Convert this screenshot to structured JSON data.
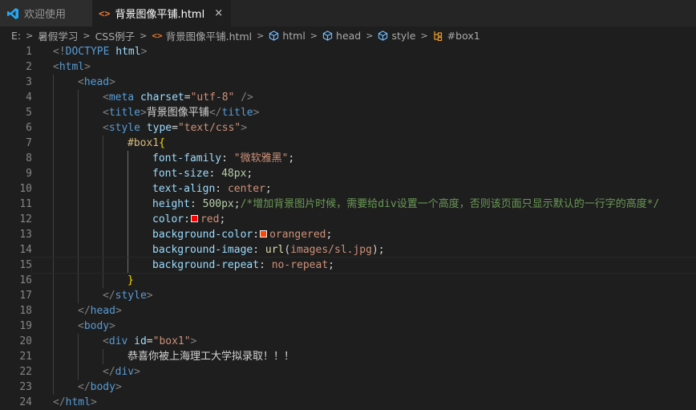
{
  "tabs": [
    {
      "label": "欢迎使用",
      "active": false
    },
    {
      "label": "背景图像平铺.html",
      "active": true,
      "close": "×"
    }
  ],
  "breadcrumb": [
    "E:",
    "暑假学习",
    "CSS例子",
    "背景图像平铺.html",
    "html",
    "head",
    "style",
    "#box1"
  ],
  "colors": {
    "red": "#ff0000",
    "orangered": "#ff4500",
    "accent": "#0078d4"
  },
  "icons": {
    "app": "vscode-icon",
    "file": "html-icon",
    "close": "close-icon",
    "element": "cube-icon",
    "selector": "selector-icon"
  },
  "editor": {
    "lines": [
      {
        "n": "1",
        "i": 0,
        "t": [
          [
            "punc",
            "<!"
          ],
          [
            "tag",
            "DOCTYPE"
          ],
          [
            "txt",
            " "
          ],
          [
            "attr",
            "html"
          ],
          [
            "punc",
            ">"
          ]
        ]
      },
      {
        "n": "2",
        "i": 0,
        "t": [
          [
            "punc",
            "<"
          ],
          [
            "tag",
            "html"
          ],
          [
            "punc",
            ">"
          ]
        ]
      },
      {
        "n": "3",
        "i": 1,
        "t": [
          [
            "punc",
            "<"
          ],
          [
            "tag",
            "head"
          ],
          [
            "punc",
            ">"
          ]
        ]
      },
      {
        "n": "4",
        "i": 2,
        "t": [
          [
            "punc",
            "<"
          ],
          [
            "tag",
            "meta"
          ],
          [
            "txt",
            " "
          ],
          [
            "attr",
            "charset"
          ],
          [
            "txt",
            "="
          ],
          [
            "str",
            "\"utf-8\""
          ],
          [
            "txt",
            " "
          ],
          [
            "punc",
            "/>"
          ]
        ]
      },
      {
        "n": "5",
        "i": 2,
        "t": [
          [
            "punc",
            "<"
          ],
          [
            "tag",
            "title"
          ],
          [
            "punc",
            ">"
          ],
          [
            "txt",
            "背景图像平铺"
          ],
          [
            "punc",
            "</"
          ],
          [
            "tag",
            "title"
          ],
          [
            "punc",
            ">"
          ]
        ]
      },
      {
        "n": "6",
        "i": 2,
        "t": [
          [
            "punc",
            "<"
          ],
          [
            "tag",
            "style"
          ],
          [
            "txt",
            " "
          ],
          [
            "attr",
            "type"
          ],
          [
            "txt",
            "="
          ],
          [
            "str",
            "\"text/css\""
          ],
          [
            "punc",
            ">"
          ]
        ]
      },
      {
        "n": "7",
        "i": 3,
        "t": [
          [
            "sel",
            "#box1"
          ],
          [
            "brace",
            "{"
          ]
        ]
      },
      {
        "n": "8",
        "i": 4,
        "t": [
          [
            "prop",
            "font-family"
          ],
          [
            "txt",
            ": "
          ],
          [
            "val",
            "\"微软雅黑\""
          ],
          [
            "txt",
            ";"
          ]
        ]
      },
      {
        "n": "9",
        "i": 4,
        "t": [
          [
            "prop",
            "font-size"
          ],
          [
            "txt",
            ": "
          ],
          [
            "num",
            "48px"
          ],
          [
            "txt",
            ";"
          ]
        ]
      },
      {
        "n": "10",
        "i": 4,
        "t": [
          [
            "prop",
            "text-align"
          ],
          [
            "txt",
            ": "
          ],
          [
            "val",
            "center"
          ],
          [
            "txt",
            ";"
          ]
        ]
      },
      {
        "n": "11",
        "i": 4,
        "t": [
          [
            "prop",
            "height"
          ],
          [
            "txt",
            ": "
          ],
          [
            "num",
            "500px"
          ],
          [
            "txt",
            ";"
          ],
          [
            "com",
            "/*增加背景图片时候，需要给div设置一个高度，否则该页面只显示默认的一行字的高度*/"
          ]
        ]
      },
      {
        "n": "12",
        "i": 4,
        "t": [
          [
            "prop",
            "color"
          ],
          [
            "txt",
            ":"
          ],
          [
            "swatch",
            "red"
          ],
          [
            "val",
            "red"
          ],
          [
            "txt",
            ";"
          ]
        ]
      },
      {
        "n": "13",
        "i": 4,
        "t": [
          [
            "prop",
            "background-color"
          ],
          [
            "txt",
            ":"
          ],
          [
            "swatch",
            "orangered"
          ],
          [
            "val",
            "orangered"
          ],
          [
            "txt",
            ";"
          ]
        ]
      },
      {
        "n": "14",
        "i": 4,
        "t": [
          [
            "prop",
            "background-image"
          ],
          [
            "txt",
            ": "
          ],
          [
            "fn",
            "url"
          ],
          [
            "txt",
            "("
          ],
          [
            "val",
            "images/sl.jpg"
          ],
          [
            "txt",
            ");"
          ]
        ]
      },
      {
        "n": "15",
        "i": 4,
        "t": [
          [
            "prop",
            "background-repeat"
          ],
          [
            "txt",
            ": "
          ],
          [
            "val",
            "no-repeat"
          ],
          [
            "txt",
            ";"
          ]
        ],
        "current": true
      },
      {
        "n": "16",
        "i": 3,
        "t": [
          [
            "brace",
            "}"
          ]
        ]
      },
      {
        "n": "17",
        "i": 2,
        "t": [
          [
            "punc",
            "</"
          ],
          [
            "tag",
            "style"
          ],
          [
            "punc",
            ">"
          ]
        ]
      },
      {
        "n": "18",
        "i": 1,
        "t": [
          [
            "punc",
            "</"
          ],
          [
            "tag",
            "head"
          ],
          [
            "punc",
            ">"
          ]
        ]
      },
      {
        "n": "19",
        "i": 1,
        "t": [
          [
            "punc",
            "<"
          ],
          [
            "tag",
            "body"
          ],
          [
            "punc",
            ">"
          ]
        ]
      },
      {
        "n": "20",
        "i": 2,
        "t": [
          [
            "punc",
            "<"
          ],
          [
            "tag",
            "div"
          ],
          [
            "txt",
            " "
          ],
          [
            "attr",
            "id"
          ],
          [
            "txt",
            "="
          ],
          [
            "str",
            "\"box1\""
          ],
          [
            "punc",
            ">"
          ]
        ]
      },
      {
        "n": "21",
        "i": 3,
        "t": [
          [
            "txt",
            "恭喜你被上海理工大学拟录取！！！"
          ]
        ]
      },
      {
        "n": "22",
        "i": 2,
        "t": [
          [
            "punc",
            "</"
          ],
          [
            "tag",
            "div"
          ],
          [
            "punc",
            ">"
          ]
        ]
      },
      {
        "n": "23",
        "i": 1,
        "t": [
          [
            "punc",
            "</"
          ],
          [
            "tag",
            "body"
          ],
          [
            "punc",
            ">"
          ]
        ]
      },
      {
        "n": "24",
        "i": 0,
        "t": [
          [
            "punc",
            "</"
          ],
          [
            "tag",
            "html"
          ],
          [
            "punc",
            ">"
          ]
        ]
      }
    ]
  }
}
